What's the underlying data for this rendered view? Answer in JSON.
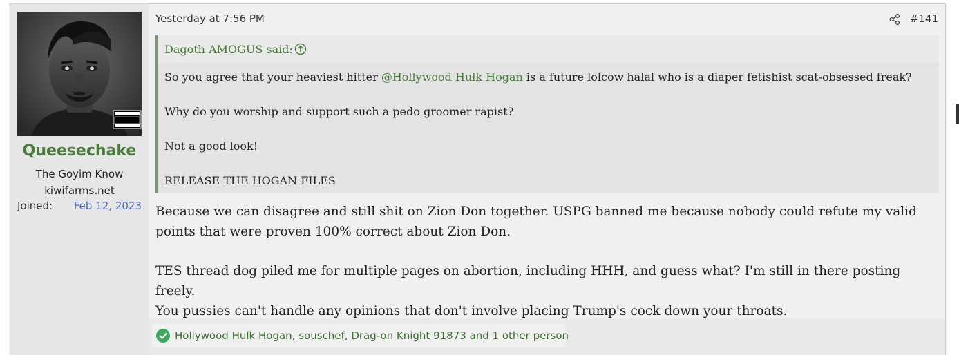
{
  "user": {
    "name": "Queesechake",
    "title": "The Goyim Know",
    "site": "kiwifarms.net",
    "joined_label": "Joined:",
    "joined_date": "Feb 12, 2023",
    "avatar_badge": "PARENTAL ADVISORY"
  },
  "post": {
    "time": "Yesterday at 7:56 PM",
    "number": "#141",
    "quote": {
      "author": "Dagoth AMOGUS said:",
      "line1_before": "So you agree that your heaviest hitter ",
      "mention": "@Hollywood Hulk Hogan",
      "line1_after": " is a future lolcow halal who is a diaper fetishist scat-obsessed freak?",
      "line2": "Why do you worship and support such a pedo groomer rapist?",
      "line3": "Not a good look!",
      "line4": "RELEASE THE HOGAN FILES"
    },
    "body": {
      "para1_line1": "Because we can disagree and still shit on Zion Don together. USPG banned me because nobody could refute my valid",
      "para1_line2": "points that were proven 100% correct about Zion Don.",
      "para2_line1": "TES thread dog piled me for multiple pages on abortion, including HHH, and guess what? I'm still in there posting freely.",
      "para2_line2": "You pussies can't handle any opinions that don't involve placing Trump's cock down your throats."
    }
  },
  "reactions": {
    "text": "Hollywood Hulk Hogan, souschef, Drag-on Knight 91873 and 1 other person",
    "icon": "check-circle-icon"
  },
  "colors": {
    "username": "#4a7a3c",
    "joined_date": "#4f6ac9",
    "quote_border": "#6da55e",
    "reaction_icon": "#3daa5f"
  }
}
